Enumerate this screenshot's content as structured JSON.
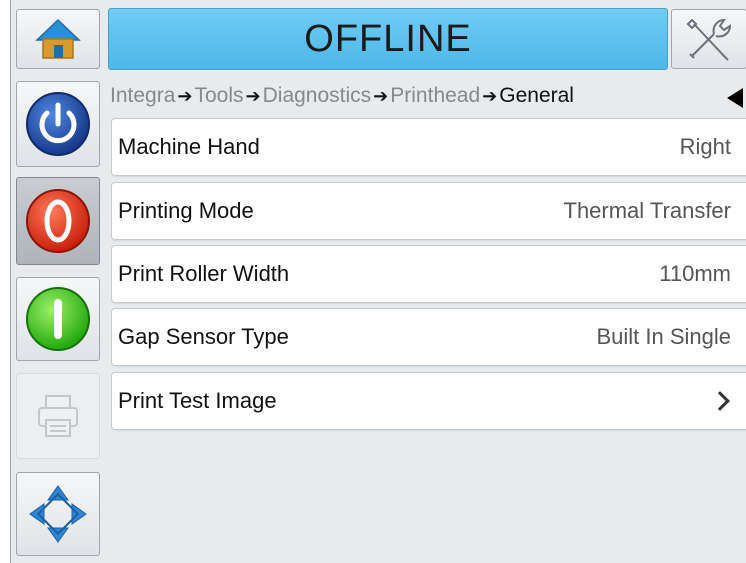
{
  "header": {
    "status": "OFFLINE",
    "home_icon": "home-icon",
    "tools_icon": "tools-icon",
    "status_color": "#5cc1ee"
  },
  "sidebar": {
    "buttons": [
      {
        "name": "power-button",
        "icon": "power-icon",
        "color": "#1f4fa6"
      },
      {
        "name": "stop-button",
        "icon": "stop-icon",
        "color": "#e23b1e"
      },
      {
        "name": "start-button",
        "icon": "start-icon",
        "color": "#35c21a"
      },
      {
        "name": "printer-button",
        "icon": "printer-icon",
        "state": "disabled"
      },
      {
        "name": "navigation-button",
        "icon": "navigation-arrows-icon",
        "color": "#2c86d6"
      }
    ]
  },
  "breadcrumb": {
    "items": [
      "Integra",
      "Tools",
      "Diagnostics",
      "Printhead",
      "General"
    ],
    "back_icon": "back-arrow-icon"
  },
  "rows": [
    {
      "label": "Machine Hand",
      "value": "Right"
    },
    {
      "label": "Printing Mode",
      "value": "Thermal Transfer"
    },
    {
      "label": "Print Roller Width",
      "value": "110mm"
    },
    {
      "label": "Gap Sensor Type",
      "value": "Built In Single"
    },
    {
      "label": "Print Test Image",
      "value": "",
      "icon": "chevron-right-icon"
    }
  ]
}
